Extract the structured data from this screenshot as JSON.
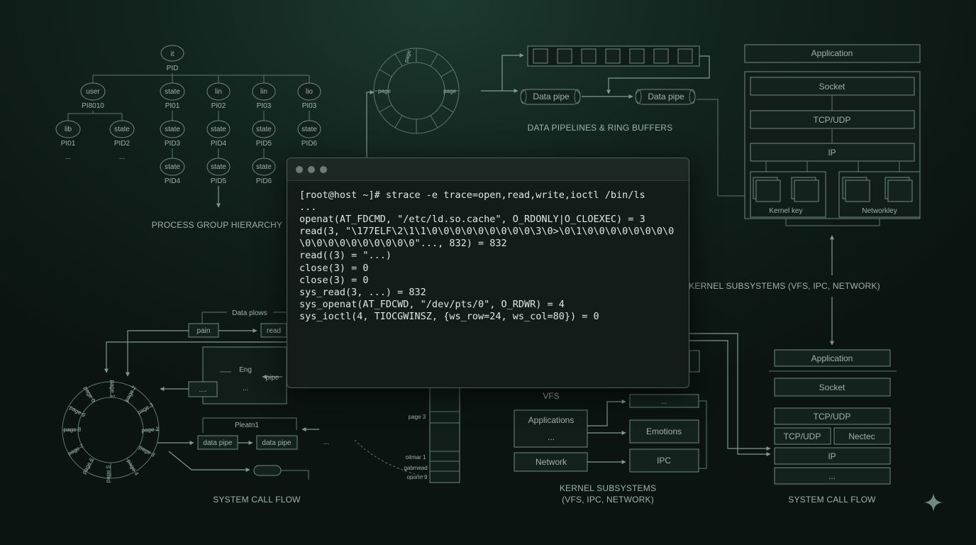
{
  "captions": {
    "process_group": "PROCESS GROUP HIERARCHY",
    "pipelines": "DATA PIPELINES & RING BUFFERS",
    "kernel_right": "KERNEL SUBSYSTEMS (VFS, IPC, NETWORK)",
    "syscall_left": "SYSTEM CALL FLOW",
    "kernel_bottom_1": "KERNEL SUBSYSTEMS",
    "kernel_bottom_2": "(VFS, IPC, NETWORK)",
    "syscall_right": "SYSTEM CALL FLOW"
  },
  "process_tree": {
    "root": {
      "node": "it",
      "label": "PID"
    },
    "level1": [
      {
        "node": "user",
        "label": "PI8010"
      },
      {
        "node": "state",
        "label": "PI01"
      },
      {
        "node": "lin",
        "label": "PI02"
      },
      {
        "node": "lin",
        "label": "PI03"
      },
      {
        "node": "lio",
        "label": "PI03"
      }
    ],
    "level2": [
      {
        "node": "lib",
        "label": "PI01"
      },
      {
        "node": "state",
        "label": "PID2"
      },
      {
        "node": "state",
        "label": "PID3"
      },
      {
        "node": "state",
        "label": "PID4"
      },
      {
        "node": "state",
        "label": "PID5"
      },
      {
        "node": "state",
        "label": "PID6"
      }
    ],
    "level3": [
      {
        "node": "state",
        "label": "PID4"
      },
      {
        "node": "state",
        "label": "PID5"
      },
      {
        "node": "state",
        "label": "PID6"
      }
    ],
    "ellipsis": "..."
  },
  "ring_top": {
    "page_label": "page",
    "page_top": "page"
  },
  "pipes": {
    "pipe1": "Data pipe",
    "pipe2": "Data pipe"
  },
  "stack_right": {
    "application": "Application",
    "socket": "Socket",
    "tcpudp": "TCP/UDP",
    "ip": "IP",
    "kernel_key": "Kernel key",
    "network_key": "Networkley"
  },
  "stack_bottom": {
    "application": "Application",
    "socket": "Socket",
    "tcpudp": "TCP/UDP",
    "tcpudp2": "TCP/UDP",
    "nectec": "Nectec",
    "ip": "IP",
    "more": "..."
  },
  "syscall_flow": {
    "data_plows": "Data plows",
    "pain": "pain",
    "read": "read",
    "eng": "Eng",
    "pipe": "pipe",
    "dots": "....",
    "more": "...",
    "pleatn": "Pleatn1",
    "data_pipe_1": "data pipe",
    "data_pipe_2": "data pipe",
    "ring_pages": [
      "page 2",
      "page 3",
      "page 4",
      "page 5",
      "page 6",
      "page 7",
      "page 8",
      "page 9",
      "page 0",
      "page 1",
      "page 2",
      "page 3"
    ]
  },
  "kernel_bottom": {
    "vfs": "VFS",
    "applications": "Applications",
    "more": "...",
    "network": "Network",
    "emotions": "Emotions",
    "ipc": "IPC",
    "more2": "...",
    "page3": "page 3",
    "oitmar": "oitmar 1",
    "gabmead": "gabmead",
    "oponn": "oponn 9"
  },
  "terminal": {
    "lines": [
      "[root@host ~]# strace -e trace=open,read,write,ioctl /bin/ls",
      "...",
      "openat(AT_FDCMD, \"/etc/ld.so.cache\", O_RDONLY|O_CLOEXEC) = 3",
      "read(3, \"\\177ELF\\2\\1\\1\\0\\0\\0\\0\\0\\0\\0\\0\\0\\3\\0>\\0\\1\\0\\0\\0\\0\\0\\0\\0\\0",
      "\\0\\0\\0\\0\\0\\0\\0\\0\\0\\0\"..., 832) = 832",
      "read((3) = \"...)",
      "close(3) = 0",
      "close(3) = 0",
      "sys_read(3, ...) = 832",
      "sys_openat(AT_FDCWD, \"/dev/pts/0\", O_RDWR) = 4",
      "sys_ioctl(4, TIOCGWINSZ, {ws_row=24, ws_col=80}) = 0"
    ]
  },
  "colors": {
    "background": "#12231d",
    "terminal_bg": "#141c19",
    "line": "#5f7870",
    "text": "#dfe7e3"
  }
}
